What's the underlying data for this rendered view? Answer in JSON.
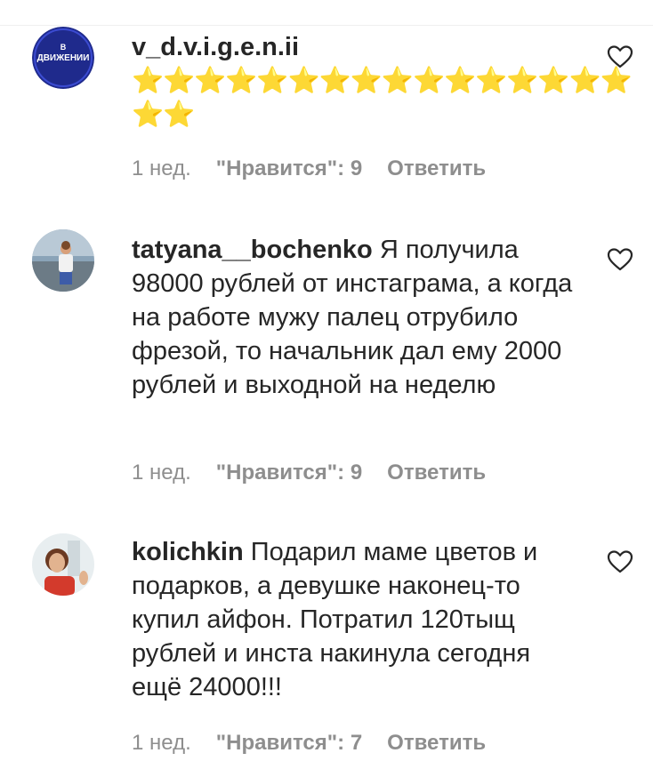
{
  "comments": [
    {
      "username": "v_d.v.i.g.e.n.ii",
      "text": "",
      "stars_line1": "⭐⭐⭐⭐⭐⭐⭐⭐⭐⭐⭐⭐⭐⭐⭐⭐",
      "stars_line2": "⭐⭐",
      "avatar_label_top": "В",
      "avatar_label": "ДВИЖЕНИИ",
      "time": "1 нед.",
      "likes": "\"Нравится\": 9",
      "reply": "Ответить"
    },
    {
      "username": "tatyana__bochenko",
      "text": "Я получила 98000 рублей от инстаграма, а когда на работе мужу палец отрубило фрезой, то начальник дал ему 2000 рублей и выходной на неделю",
      "time": "1 нед.",
      "likes": "\"Нравится\": 9",
      "reply": "Ответить"
    },
    {
      "username": "kolichkin",
      "text": "Подарил маме цветов и подарков, а девушке наконец-то купил айфон. Потратил 120тыщ рублей и инста накинула сегодня ещё 24000!!!",
      "time": "1 нед.",
      "likes": "\"Нравится\": 7",
      "reply": "Ответить"
    }
  ],
  "colors": {
    "text": "#262626",
    "meta": "#8e8e8e",
    "stars": "#f5c518",
    "avatar_blue": "#1f2a8c"
  }
}
